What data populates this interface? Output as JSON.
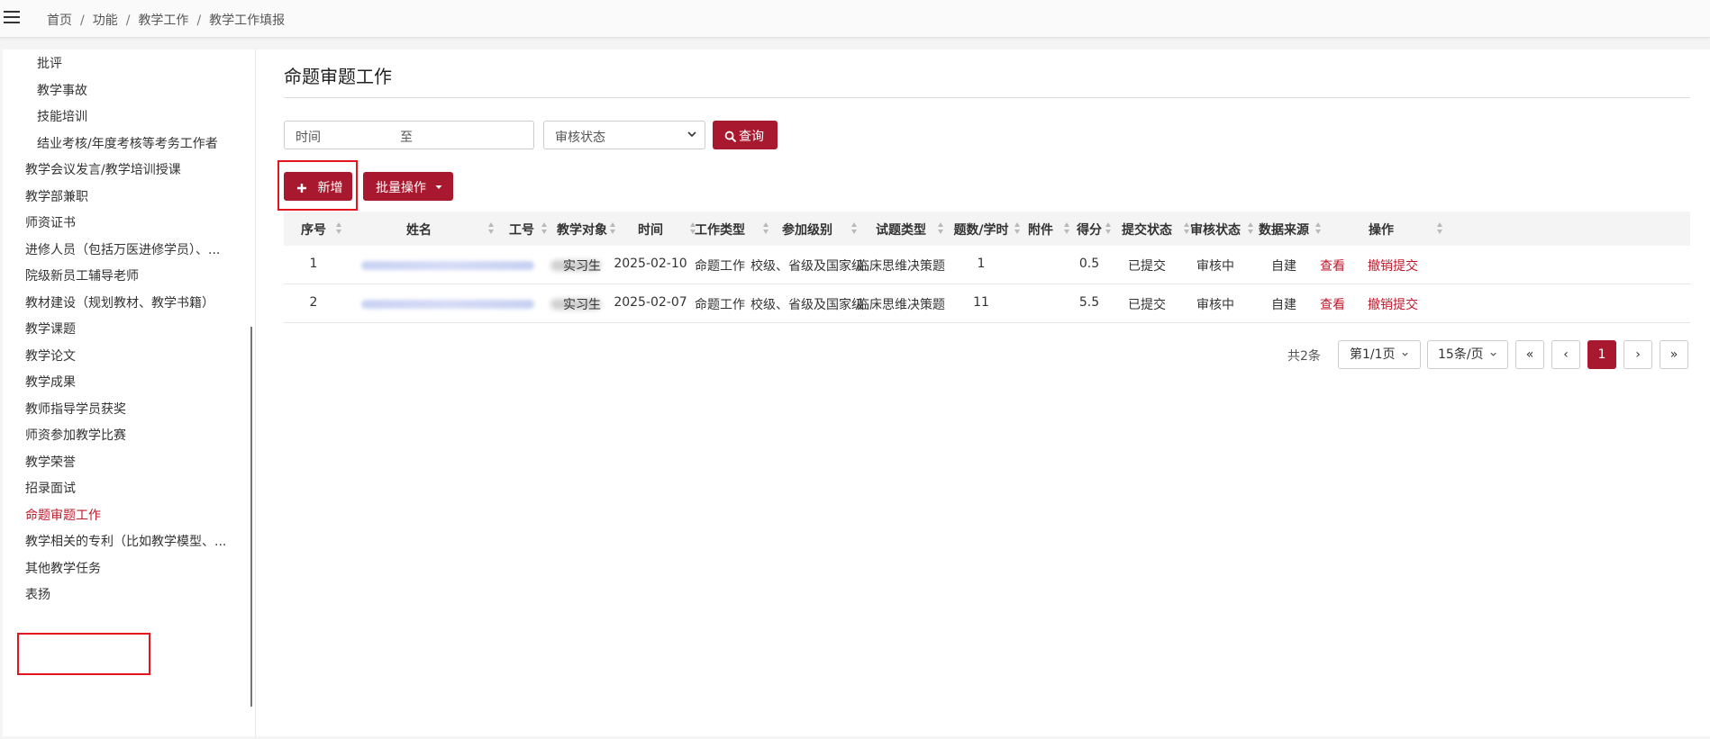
{
  "breadcrumb": [
    "首页",
    "功能",
    "教学工作",
    "教学工作填报"
  ],
  "breadcrumb_separator": "/",
  "sidebar": {
    "items": [
      {
        "label": "批评",
        "level": 2,
        "active": false
      },
      {
        "label": "教学事故",
        "level": 2,
        "active": false
      },
      {
        "label": "技能培训",
        "level": 2,
        "active": false
      },
      {
        "label": "结业考核/年度考核等考务工作者",
        "level": 2,
        "active": false
      },
      {
        "label": "教学会议发言/教学培训授课",
        "level": 1,
        "active": false
      },
      {
        "label": "教学部兼职",
        "level": 1,
        "active": false
      },
      {
        "label": "师资证书",
        "level": 1,
        "active": false
      },
      {
        "label": "进修人员（包括万医进修学员）、...",
        "level": 1,
        "active": false
      },
      {
        "label": "院级新员工辅导老师",
        "level": 1,
        "active": false
      },
      {
        "label": "教材建设（规划教材、教学书籍）",
        "level": 1,
        "active": false
      },
      {
        "label": "教学课题",
        "level": 1,
        "active": false
      },
      {
        "label": "教学论文",
        "level": 1,
        "active": false
      },
      {
        "label": "教学成果",
        "level": 1,
        "active": false
      },
      {
        "label": "教师指导学员获奖",
        "level": 1,
        "active": false
      },
      {
        "label": "师资参加教学比赛",
        "level": 1,
        "active": false
      },
      {
        "label": "教学荣誉",
        "level": 1,
        "active": false
      },
      {
        "label": "招录面试",
        "level": 1,
        "active": false
      },
      {
        "label": "命题审题工作",
        "level": 1,
        "active": true
      },
      {
        "label": "教学相关的专利（比如教学模型、...",
        "level": 1,
        "active": false
      },
      {
        "label": "其他教学任务",
        "level": 1,
        "active": false
      },
      {
        "label": "表扬",
        "level": 1,
        "active": false
      }
    ]
  },
  "page": {
    "title": "命题审题工作"
  },
  "filters": {
    "time_start_placeholder": "时间",
    "time_separator": "至",
    "status_select": "审核状态",
    "query_label": "查询"
  },
  "actions": {
    "add_label": "新增",
    "batch_label": "批量操作"
  },
  "table": {
    "columns": [
      "序号",
      "姓名",
      "工号",
      "教学对象",
      "时间",
      "工作类型",
      "参加级别",
      "试题类型",
      "题数/学时",
      "附件",
      "得分",
      "提交状态",
      "审核状态",
      "数据来源",
      "操作"
    ],
    "rows": [
      {
        "index": "1",
        "name": "",
        "staff_id": "",
        "target": "实习生",
        "date": "2025-02-10",
        "work_type": "命题工作",
        "level": "校级、省级及国家级",
        "question_type": "临床思维决策题",
        "count": "1",
        "attachment": "",
        "score": "0.5",
        "submit_status": "已提交",
        "review_status": "审核中",
        "source": "自建",
        "view_label": "查看",
        "revoke_label": "撤销提交"
      },
      {
        "index": "2",
        "name": "",
        "staff_id": "",
        "target": "实习生",
        "date": "2025-02-07",
        "work_type": "命题工作",
        "level": "校级、省级及国家级",
        "question_type": "临床思维决策题",
        "count": "11",
        "attachment": "",
        "score": "5.5",
        "submit_status": "已提交",
        "review_status": "审核中",
        "source": "自建",
        "view_label": "查看",
        "revoke_label": "撤销提交"
      }
    ]
  },
  "pagination": {
    "total_text": "共2条",
    "page_select": "第1/1页",
    "page_size_select": "15条/页",
    "first": "«",
    "prev": "‹",
    "current": "1",
    "next": "›",
    "last": "»"
  },
  "colors": {
    "accent": "#a8192f",
    "active_link": "#c0192c",
    "highlight_box": "#e5141f"
  }
}
